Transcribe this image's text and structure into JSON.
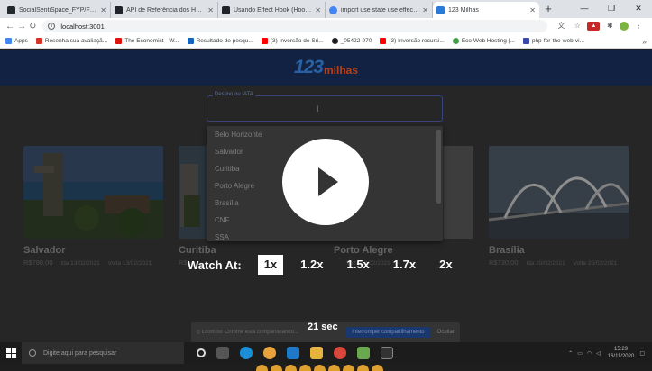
{
  "browser": {
    "tabs": [
      {
        "title": "SocialSentiSpace_FYP/Facebo...",
        "favicon_color": "#24292e"
      },
      {
        "title": "API de Referência dos Hooks ...",
        "favicon_color": "#20232a"
      },
      {
        "title": "Usando Effect Hook (Hook do...",
        "favicon_color": "#20232a"
      },
      {
        "title": "import use state use effect re...",
        "favicon_color": "#4285f4"
      },
      {
        "title": "123 Milhas",
        "favicon_color": "#2a7bd5",
        "active": true
      }
    ],
    "new_tab_label": "+",
    "window_controls": [
      "—",
      "❐",
      "✕"
    ],
    "url": "localhost:3001",
    "bookmarks": [
      {
        "label": "Apps",
        "icon_color": "#4285f4"
      },
      {
        "label": "Resenha sua avaliaçã...",
        "icon_color": "#d93025"
      },
      {
        "label": "The Economist - W...",
        "icon_color": "#e3120b"
      },
      {
        "label": "Resultado de pesqu...",
        "icon_color": "#1565c0"
      },
      {
        "label": "(3) Inversão de Sri...",
        "icon_color": "#ff0000"
      },
      {
        "label": "_05422-970",
        "icon_color": "#202124"
      },
      {
        "label": "(3) Inversão recursi...",
        "icon_color": "#ff0000"
      },
      {
        "label": "Eco Web Hosting |...",
        "icon_color": "#43a047"
      },
      {
        "label": "php-for-the-web-vi...",
        "icon_color": "#3949ab"
      }
    ],
    "bookmarks_more": "»"
  },
  "app": {
    "logo_number": "123",
    "logo_word": "milhas",
    "search": {
      "label": "Destino ou IATA",
      "value": ""
    },
    "dropdown_options": [
      "Belo Horizonte",
      "Salvador",
      "Curitiba",
      "Porto Alegre",
      "Brasília",
      "CNF",
      "SSA"
    ],
    "cards": [
      {
        "city": "Salvador",
        "price": "R$780,00",
        "ida": "Ida 13/02/2021",
        "volta": "Volta 13/02/2021"
      },
      {
        "city": "Curitiba",
        "price": "R$...",
        "ida": "",
        "volta": ""
      },
      {
        "city": "Porto Alegre",
        "price": "",
        "ida": "",
        "volta": "Volta 13/02/2021"
      },
      {
        "city": "Brasília",
        "price": "R$730,00",
        "ida": "Ida 20/02/2021",
        "volta": "Volta 25/02/2021"
      }
    ],
    "share_bar": {
      "text": "⦸ Loom for Chrome está compartilhando...",
      "stop_label": "Interromper compartilhamento",
      "hide_label": "Ocultar"
    }
  },
  "player": {
    "watch_label": "Watch At:",
    "speeds": [
      "1x",
      "1.2x",
      "1.5x",
      "1.7x",
      "2x"
    ],
    "selected_speed": "1x",
    "timer": "21 sec"
  },
  "taskbar": {
    "search_placeholder": "Digite aqui para pesquisar",
    "clock_time": "15:29",
    "clock_date": "16/11/2020"
  }
}
